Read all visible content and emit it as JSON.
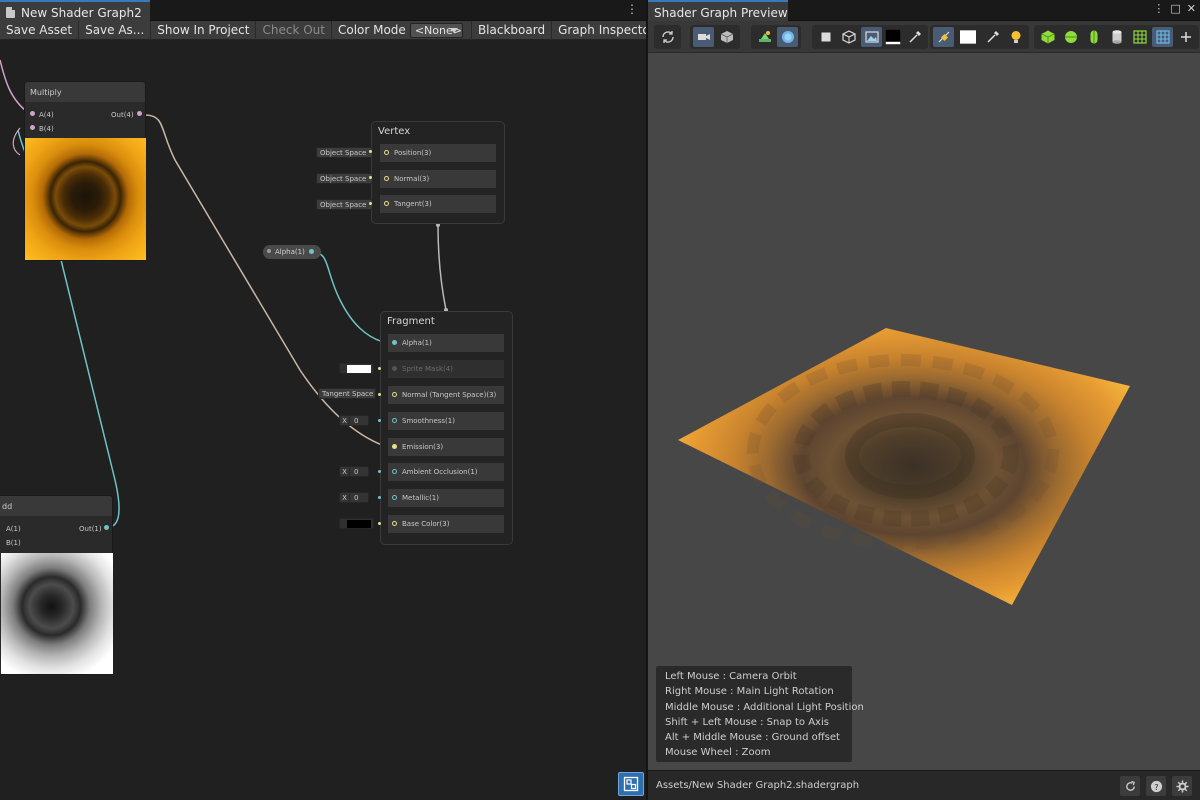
{
  "left_window": {
    "tab_title": "New Shader Graph2",
    "menu_icon": "kebab-menu-icon"
  },
  "toolbar": {
    "save_asset": "Save Asset",
    "save_as": "Save As...",
    "show_in_project": "Show In Project",
    "check_out": "Check Out",
    "color_mode_label": "Color Mode",
    "color_mode_value": "<None>",
    "blackboard": "Blackboard",
    "graph_inspector": "Graph Inspector"
  },
  "graph": {
    "multiply_node": {
      "title": "Multiply",
      "input_a": "A(4)",
      "input_b": "B(4)",
      "output": "Out(4)"
    },
    "add_node": {
      "title": "dd",
      "input_a": "A(1)",
      "input_b": "B(1)",
      "output": "Out(1)"
    },
    "alpha_property": "Alpha(1)",
    "vertex_block": {
      "title": "Vertex",
      "slots": [
        {
          "label": "Position(3)",
          "space": "Object Space"
        },
        {
          "label": "Normal(3)",
          "space": "Object Space"
        },
        {
          "label": "Tangent(3)",
          "space": "Object Space"
        }
      ]
    },
    "fragment_block": {
      "title": "Fragment",
      "slots": [
        {
          "label": "Alpha(1)"
        },
        {
          "label": "Sprite Mask(4)"
        },
        {
          "label": "Normal (Tangent Space)(3)",
          "space": "Tangent Space"
        },
        {
          "label": "Smoothness(1)",
          "x_label": "X",
          "x_value": "0"
        },
        {
          "label": "Emission(3)"
        },
        {
          "label": "Ambient Occlusion(1)",
          "x_label": "X",
          "x_value": "0"
        },
        {
          "label": "Metallic(1)",
          "x_label": "X",
          "x_value": "0"
        },
        {
          "label": "Base Color(3)",
          "swatch_color": "#000000"
        }
      ]
    },
    "wire_colors": {
      "vector4": "#d2a3c8",
      "vector3": "#e4e08a",
      "vector1": "#6ec4c4",
      "flow": "#b8b8b8"
    }
  },
  "right_window": {
    "tab_title": "Shader Graph Preview",
    "controls": [
      "⋮",
      "□",
      "✕"
    ],
    "help_lines": [
      "Left Mouse : Camera Orbit",
      "Right Mouse : Main Light Rotation",
      "Middle Mouse : Additional Light Position",
      "Shift + Left Mouse : Snap to Axis",
      "Alt + Middle Mouse : Ground offset",
      "Mouse Wheel : Zoom"
    ],
    "asset_path": "Assets/New Shader Graph2.shadergraph",
    "toolbar_icons": [
      "refresh-icon",
      "camera-icon",
      "cube-icon",
      "scene-lighting-icon",
      "skybox-icon",
      "square-mesh-icon",
      "cube-mesh-icon",
      "image-icon",
      "background-color-swatch",
      "eyedropper-icon",
      "light-gizmo-icon",
      "white-swatch",
      "eyedropper-icon",
      "light-bulb-icon",
      "cube-green-icon",
      "sphere-icon",
      "capsule-icon",
      "cylinder-icon",
      "grid-icon",
      "grid-blue-icon",
      "add-icon"
    ],
    "accent_color": "#3a79bb"
  }
}
